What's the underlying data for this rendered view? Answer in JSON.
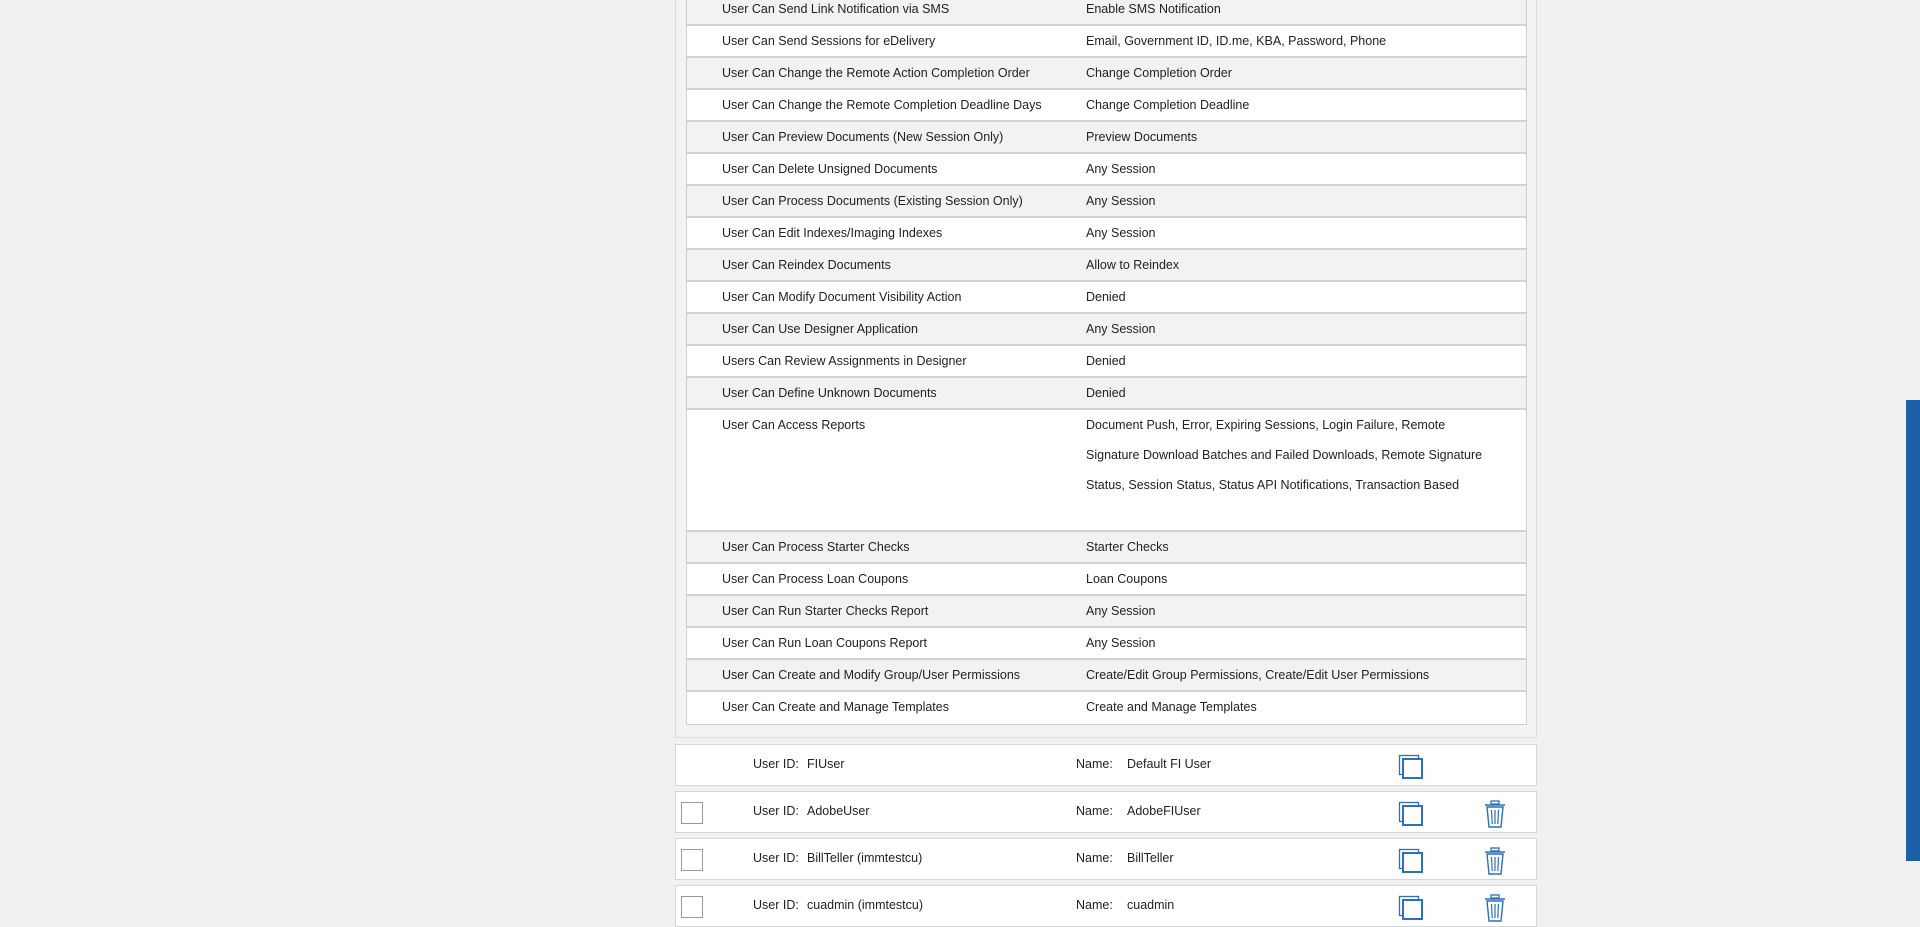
{
  "permissions": [
    {
      "name": "User Can Send Link Notification via SMS",
      "value": "Enable SMS Notification"
    },
    {
      "name": "User Can Send Sessions for eDelivery",
      "value": "Email, Government ID, ID.me, KBA, Password, Phone"
    },
    {
      "name": "User Can Change the Remote Action Completion Order",
      "value": "Change Completion Order"
    },
    {
      "name": "User Can Change the Remote Completion Deadline Days",
      "value": "Change Completion Deadline"
    },
    {
      "name": "User Can Preview Documents (New Session Only)",
      "value": "Preview Documents"
    },
    {
      "name": "User Can Delete Unsigned Documents",
      "value": "Any Session"
    },
    {
      "name": "User Can Process Documents (Existing Session Only)",
      "value": "Any Session"
    },
    {
      "name": "User Can Edit Indexes/Imaging Indexes",
      "value": "Any Session"
    },
    {
      "name": "User Can Reindex Documents",
      "value": "Allow to Reindex"
    },
    {
      "name": "User Can Modify Document Visibility Action",
      "value": "Denied"
    },
    {
      "name": "User Can Use Designer Application",
      "value": "Any Session"
    },
    {
      "name": "Users Can Review Assignments in Designer",
      "value": "Denied"
    },
    {
      "name": "User Can Define Unknown Documents",
      "value": "Denied"
    },
    {
      "name": "User Can Access Reports",
      "value": "Document Push, Error, Expiring Sessions, Login Failure, Remote Signature Download Batches and Failed Downloads, Remote Signature Status, Session Status, Status API Notifications, Transaction Based"
    },
    {
      "name": "User Can Process Starter Checks",
      "value": "Starter Checks"
    },
    {
      "name": "User Can Process Loan Coupons",
      "value": "Loan Coupons"
    },
    {
      "name": "User Can Run Starter Checks Report",
      "value": "Any Session"
    },
    {
      "name": "User Can Run Loan Coupons Report",
      "value": "Any Session"
    },
    {
      "name": "User Can Create and Modify Group/User Permissions",
      "value": "Create/Edit Group Permissions, Create/Edit User Permissions"
    },
    {
      "name": "User Can Create and Manage Templates",
      "value": "Create and Manage Templates"
    }
  ],
  "labels": {
    "user_id": "User ID:",
    "name": "Name:"
  },
  "users": [
    {
      "id": "FIUser",
      "name": "Default FI User"
    },
    {
      "id": "AdobeUser",
      "name": "AdobeFIUser"
    },
    {
      "id": "BillTeller (immtestcu)",
      "name": "BillTeller"
    },
    {
      "id": "cuadmin (immtestcu)",
      "name": "cuadmin"
    }
  ],
  "colors": {
    "accent": "#1f5fa8",
    "icon": "#2d6fb8"
  }
}
